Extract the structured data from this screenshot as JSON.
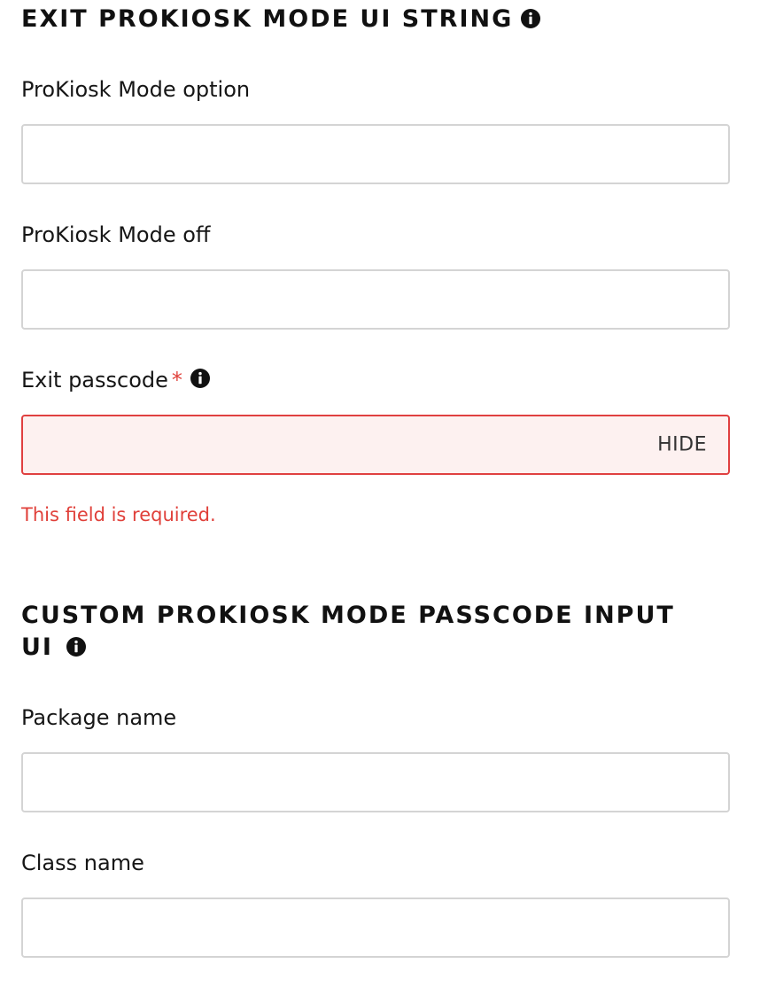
{
  "exit_section": {
    "title": "EXIT PROKIOSK MODE UI STRING",
    "info_icon": "info-circle-icon",
    "fields": {
      "mode_option": {
        "label": "ProKiosk Mode option",
        "value": "",
        "placeholder": ""
      },
      "mode_off": {
        "label": "ProKiosk Mode off",
        "value": "",
        "placeholder": ""
      },
      "exit_passcode": {
        "label": "Exit passcode",
        "required_marker": "*",
        "value": "",
        "placeholder": "",
        "toggle_label": "HIDE",
        "error": "This field is required."
      }
    }
  },
  "custom_section": {
    "title_line1": "CUSTOM PROKIOSK MODE PASSCODE INPUT",
    "title_line2": "UI",
    "info_icon": "info-circle-icon",
    "fields": {
      "package_name": {
        "label": "Package name",
        "value": "",
        "placeholder": ""
      },
      "class_name": {
        "label": "Class name",
        "value": "",
        "placeholder": ""
      }
    }
  },
  "colors": {
    "error": "#e0403a",
    "error_background": "#fdf1f0",
    "border": "#d4d4d4",
    "text": "#161616"
  }
}
